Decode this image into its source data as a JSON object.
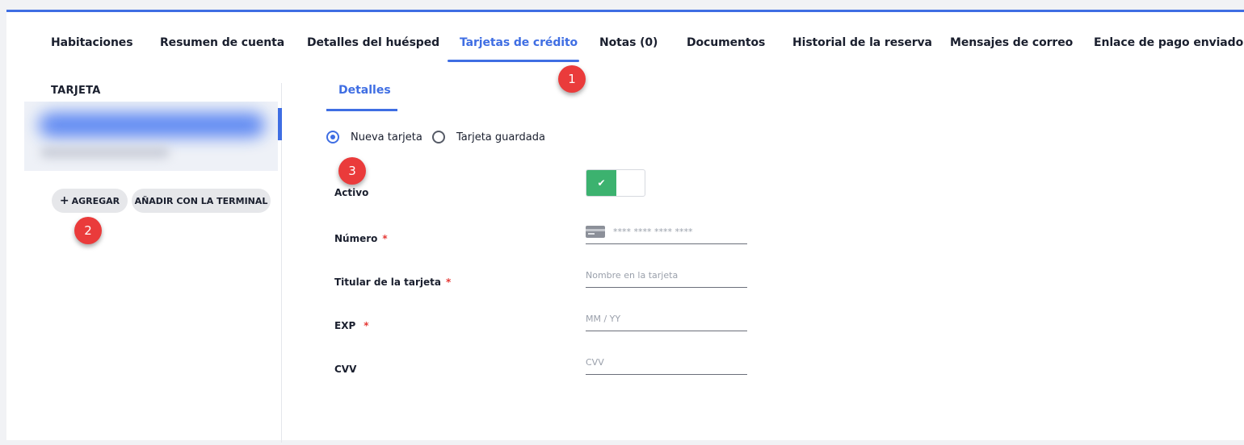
{
  "tabs": [
    {
      "label": "Habitaciones"
    },
    {
      "label": "Resumen de cuenta"
    },
    {
      "label": "Detalles del huésped"
    },
    {
      "label": "Tarjetas de crédito"
    },
    {
      "label": "Notas (0)"
    },
    {
      "label": "Documentos"
    },
    {
      "label": "Historial de la reserva"
    },
    {
      "label": "Mensajes de correo"
    },
    {
      "label": "Enlace de pago enviado"
    }
  ],
  "active_tab": "Tarjetas de crédito",
  "markers": [
    "1",
    "2",
    "3"
  ],
  "cards_panel": {
    "title": "TARJETA",
    "add_button": "AGREGAR",
    "add_terminal_button": "AÑADIR CON LA TERMINAL"
  },
  "details": {
    "tab_label": "Detalles",
    "radio_new": "Nueva tarjeta",
    "radio_saved": "Tarjeta guardada",
    "selected_option": "Nueva tarjeta",
    "active_label": "Activo",
    "active_on": true,
    "number_label": "Número",
    "number_placeholder": "**** **** **** ****",
    "holder_label": "Titular de la tarjeta",
    "holder_placeholder": "Nombre en la tarjeta",
    "exp_label": "EXP",
    "exp_placeholder": "MM / YY",
    "cvv_label": "CVV",
    "cvv_placeholder": "CVV",
    "required_mark": "*"
  },
  "colors": {
    "accent": "#3f6ee3",
    "marker": "#ea3b3b",
    "toggle_on": "#3cb26f"
  }
}
